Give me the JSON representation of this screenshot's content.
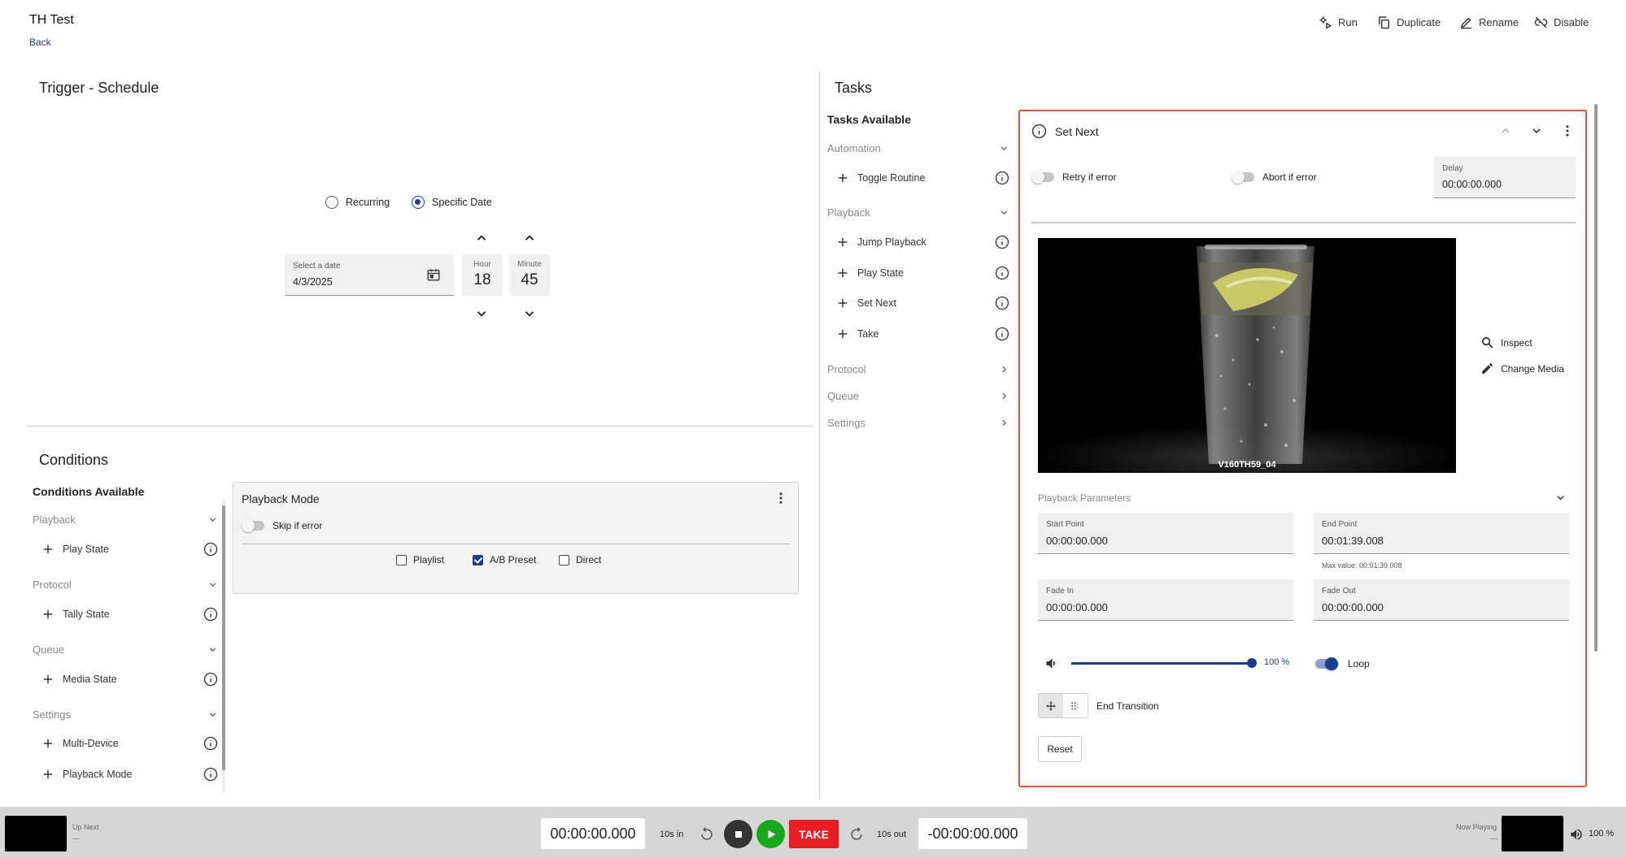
{
  "header": {
    "title": "TH Test",
    "back_label": "Back",
    "actions": [
      {
        "label": "Run",
        "icon": "run-icon"
      },
      {
        "label": "Duplicate",
        "icon": "duplicate-icon"
      },
      {
        "label": "Rename",
        "icon": "pencil-icon"
      },
      {
        "label": "Disable",
        "icon": "link-off-icon"
      }
    ]
  },
  "trigger": {
    "title": "Trigger - Schedule",
    "radio_recurring": "Recurring",
    "radio_specific": "Specific Date",
    "selected": "Specific Date",
    "date_label": "Select a date",
    "date_value": "4/3/2025",
    "hour_label": "Hour",
    "hour_value": "18",
    "minute_label": "Minute",
    "minute_value": "45"
  },
  "conditions": {
    "title": "Conditions",
    "available_label": "Conditions Available",
    "categories": [
      {
        "label": "Playback",
        "items": [
          "Play State"
        ]
      },
      {
        "label": "Protocol",
        "items": [
          "Tally State"
        ]
      },
      {
        "label": "Queue",
        "items": [
          "Media State"
        ]
      },
      {
        "label": "Settings",
        "items": [
          "Multi-Device",
          "Playback Mode"
        ]
      }
    ],
    "card": {
      "title": "Playback Mode",
      "skip_label": "Skip if error",
      "options": [
        {
          "label": "Playlist",
          "checked": false
        },
        {
          "label": "A/B Preset",
          "checked": true
        },
        {
          "label": "Direct",
          "checked": false
        }
      ]
    }
  },
  "tasks": {
    "title": "Tasks",
    "available_label": "Tasks Available",
    "categories": [
      {
        "label": "Automation",
        "expanded": true,
        "items": [
          "Toggle Routine"
        ]
      },
      {
        "label": "Playback",
        "expanded": true,
        "items": [
          "Jump Playback",
          "Play State",
          "Set Next",
          "Take"
        ]
      },
      {
        "label": "Protocol",
        "expanded": false,
        "items": []
      },
      {
        "label": "Queue",
        "expanded": false,
        "items": []
      },
      {
        "label": "Settings",
        "expanded": false,
        "items": []
      }
    ]
  },
  "set_next": {
    "title": "Set Next",
    "retry_label": "Retry if error",
    "abort_label": "Abort if error",
    "delay_label": "Delay",
    "delay_value": "00:00:00.000",
    "media_name": "V160TH59_04",
    "inspect_label": "Inspect",
    "change_media_label": "Change Media",
    "params_label": "Playback Parameters",
    "start_label": "Start Point",
    "start_value": "00:00:00.000",
    "end_label": "End Point",
    "end_value": "00:01:39.008",
    "max_value": "Max value: 00:01:39.008",
    "fade_in_label": "Fade In",
    "fade_in_value": "00:00:00.000",
    "fade_out_label": "Fade Out",
    "fade_out_value": "00:00:00.000",
    "volume_percent": 100,
    "volume_label": "100 %",
    "loop_label": "Loop",
    "loop_on": true,
    "end_transition_label": "End Transition",
    "reset_label": "Reset",
    "accent": "#e0533d"
  },
  "transport": {
    "up_next_label": "Up Next",
    "up_next_value": "---",
    "time_in": "00:00:00.000",
    "skip_in_label": "10s in",
    "take_label": "TAKE",
    "skip_out_label": "10s out",
    "time_out": "-00:00:00.000",
    "now_playing_label": "Now Playing",
    "now_playing_value": "---",
    "volume_label": "100 %",
    "take_color": "#e81e25",
    "play_color": "#17a81e"
  }
}
